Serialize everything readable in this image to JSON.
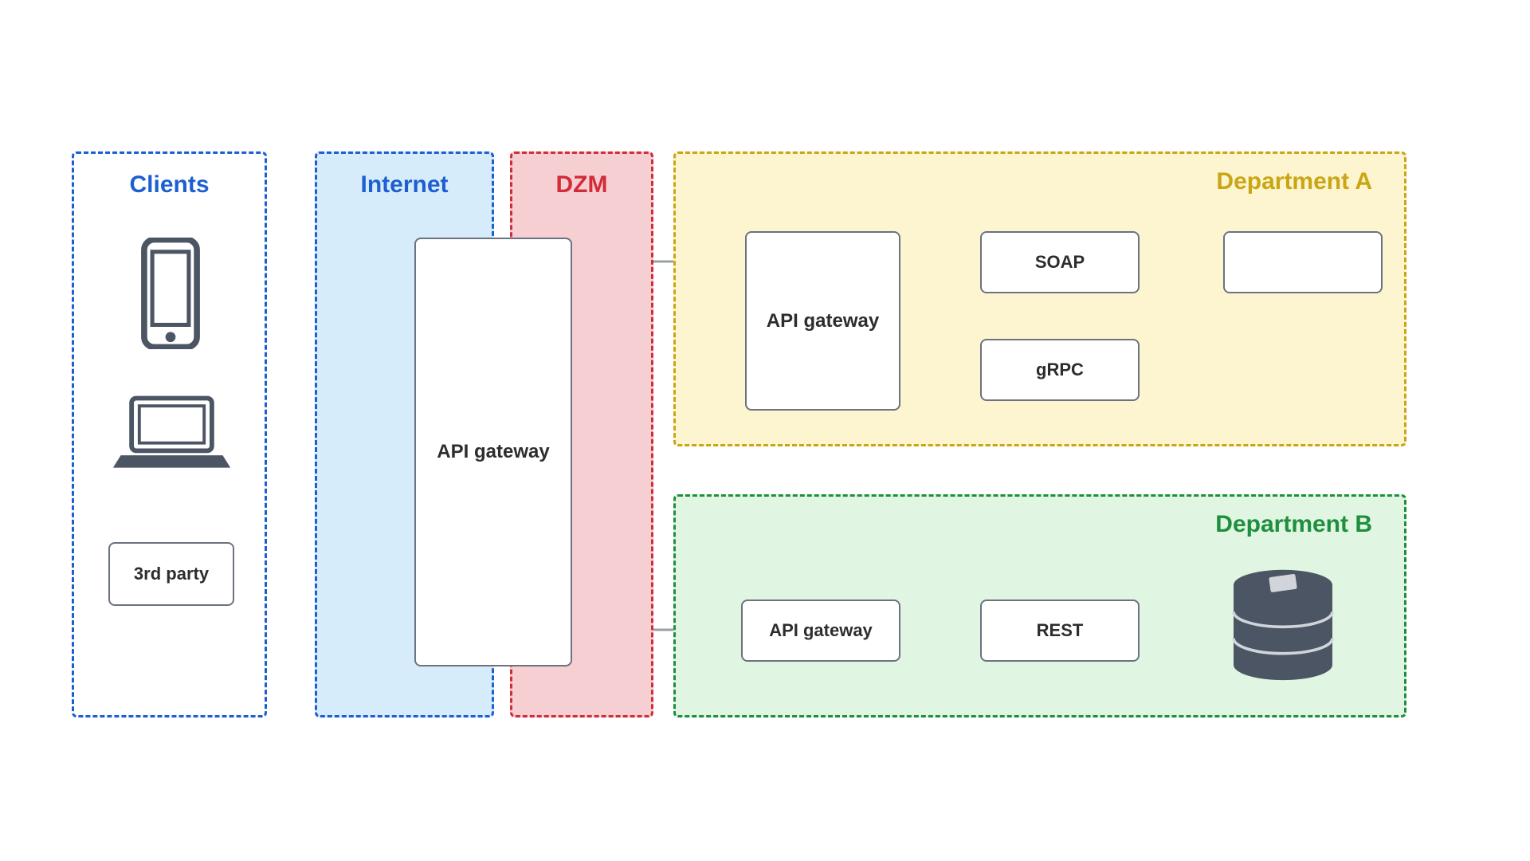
{
  "zones": {
    "clients": {
      "title": "Clients",
      "color": "#1d5fd1",
      "bg": "#ffffff"
    },
    "internet": {
      "title": "Internet",
      "color": "#1d5fd1",
      "bg": "#d7ecfb"
    },
    "dzm": {
      "title": "DZM",
      "color": "#d22c3a",
      "bg": "#f6cfd2"
    },
    "deptA": {
      "title": "Department A",
      "color": "#caa514",
      "bg": "#fdf5cf"
    },
    "deptB": {
      "title": "Department B",
      "color": "#1e8f3e",
      "bg": "#e0f5e2"
    }
  },
  "nodes": {
    "third_party": "3rd party",
    "gateway_main": "API gateway",
    "gateway_deptA": "API gateway",
    "soap": "SOAP",
    "grpc": "gRPC",
    "deptA_blank": "",
    "gateway_deptB": "API gateway",
    "rest": "REST",
    "db_icon_name": "database-icon",
    "phone_icon_name": "phone-icon",
    "laptop_icon_name": "laptop-icon"
  }
}
